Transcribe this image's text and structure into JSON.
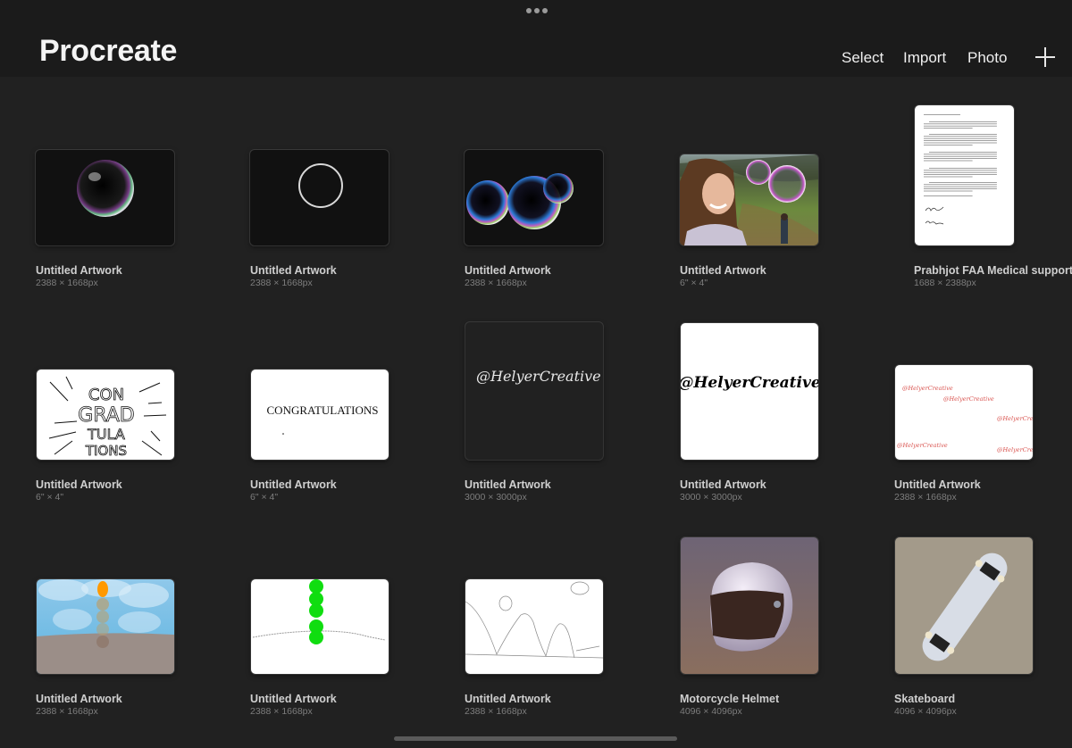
{
  "header": {
    "title": "Procreate",
    "actions": {
      "select": "Select",
      "import": "Import",
      "photo": "Photo"
    },
    "add_icon": "plus-icon",
    "multitask_icon": "more-dots-icon"
  },
  "gallery": {
    "items": [
      {
        "name": "Untitled Artwork",
        "size": "2388 × 1668px",
        "preview": "single-bubble"
      },
      {
        "name": "Untitled Artwork",
        "size": "2388 × 1668px",
        "preview": "circle-outline"
      },
      {
        "name": "Untitled Artwork",
        "size": "2388 × 1668px",
        "preview": "three-bubbles"
      },
      {
        "name": "Untitled Artwork",
        "size": "6\" × 4\"",
        "preview": "selfie-with-bubbles"
      },
      {
        "name": "Prabhjot FAA Medical support le",
        "size": "1688 × 2388px",
        "preview": "letter-document"
      },
      {
        "name": "Untitled Artwork",
        "size": "6\" × 4\"",
        "preview": "con-grad-tulations-lettering",
        "text": [
          "CON",
          "GRAD",
          "TULA",
          "TIONS"
        ]
      },
      {
        "name": "Untitled Artwork",
        "size": "6\" × 4\"",
        "preview": "congratulations-text",
        "text": "CONGRATULATIONS"
      },
      {
        "name": "Untitled Artwork",
        "size": "3000 × 3000px",
        "preview": "helyercreative-white-on-dark",
        "text": "@HelyerCreative"
      },
      {
        "name": "Untitled Artwork",
        "size": "3000 × 3000px",
        "preview": "helyercreative-black-on-white",
        "text": "@HelyerCreative"
      },
      {
        "name": "Untitled Artwork",
        "size": "2388 × 1668px",
        "preview": "helyercreative-red-pattern",
        "text": "@HelyerCreative"
      },
      {
        "name": "Untitled Artwork",
        "size": "2388 × 1668px",
        "preview": "sky-ground-orange-ball"
      },
      {
        "name": "Untitled Artwork",
        "size": "2388 × 1668px",
        "preview": "green-balls-on-line"
      },
      {
        "name": "Untitled Artwork",
        "size": "2388 × 1668px",
        "preview": "bouncing-path-sketch"
      },
      {
        "name": "Motorcycle Helmet",
        "size": "4096 × 4096px",
        "preview": "3d-helmet"
      },
      {
        "name": "Skateboard",
        "size": "4096 × 4096px",
        "preview": "3d-skateboard"
      }
    ]
  },
  "colors": {
    "background": "#212121",
    "header": "#1b1b1b",
    "title": "#f4f4f4",
    "item_name": "#cfcfcf",
    "item_size": "#7d7d7d",
    "red_watermark": "#d9534f",
    "green_ball": "#10dd10",
    "orange_ball": "#ff9900"
  }
}
